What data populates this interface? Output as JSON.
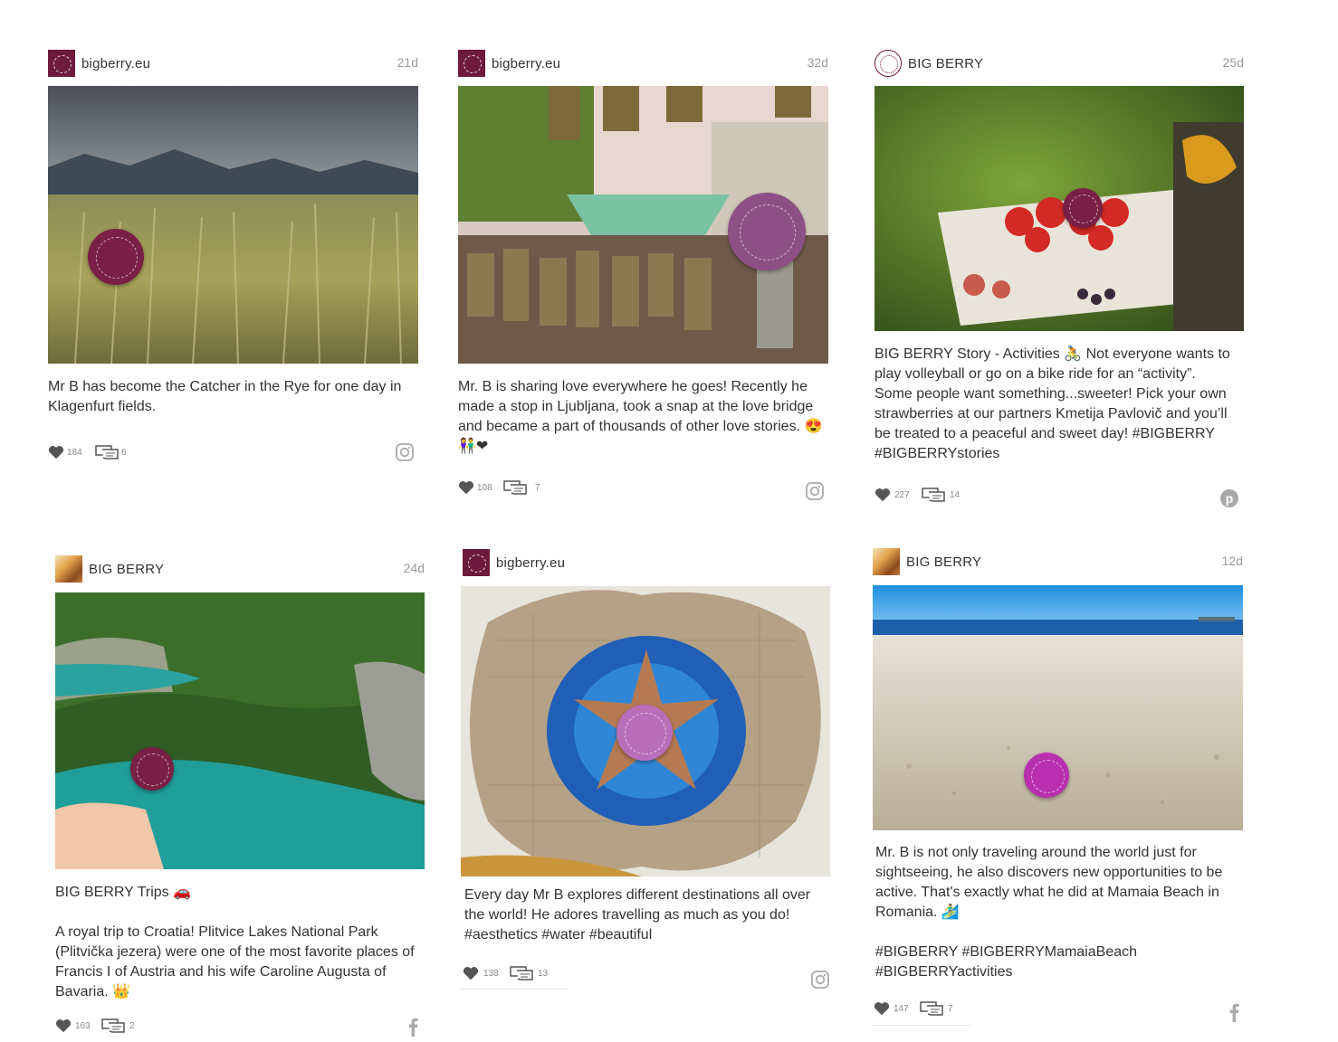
{
  "posts": [
    {
      "username": "bigberry.eu",
      "age": "21d",
      "caption": "Mr B has become the Catcher in the Rye for one day in Klagenfurt fields.",
      "likes": "184",
      "comments": "6",
      "source": "instagram-icon"
    },
    {
      "username": "bigberry.eu",
      "age": "32d",
      "caption": "Mr. B is sharing love everywhere he goes! Recently he made a stop in Ljubljana, took a snap at the love bridge and became a part of thousands of other love stories. 😍 👫❤",
      "likes": "108",
      "comments": "7",
      "source": "instagram-icon"
    },
    {
      "username": "BIG BERRY",
      "age": "25d",
      "caption": "BIG BERRY Story - Activities 🚴 Not everyone wants to play volleyball or go on a bike ride for an “activity”. Some people want something...sweeter! Pick your own strawberries at our partners Kmetija Pavlovič and you’ll be treated to a peaceful and sweet day! #BIGBERRY #BIGBERRYstories",
      "likes": "227",
      "comments": "14",
      "source": "pinterest-icon"
    },
    {
      "username": "BIG BERRY",
      "age": "24d",
      "caption": "BIG BERRY Trips 🚗\n\nA royal trip to Croatia! Plitvice Lakes National Park (Plitvička jezera) were one of the most favorite places of Francis I of Austria and his wife Caroline Augusta of Bavaria. 👑",
      "likes": "163",
      "comments": "2",
      "source": "facebook-icon"
    },
    {
      "username": "bigberry.eu",
      "age": "",
      "caption": "Every day Mr B explores different destinations all over the world! He adores travelling as much as you do! #aesthetics #water #beautiful",
      "likes": "138",
      "comments": "13",
      "source": "instagram-icon"
    },
    {
      "username": "BIG BERRY",
      "age": "12d",
      "caption": "Mr. B is not only traveling around the world just for sightseeing, he also discovers new opportunities to be active. That's exactly what he did at Mamaia Beach in Romania.   🏄‍♂️\n\n#BIGBERRY #BIGBERRYMamaiaBeach #BIGBERRYactivities",
      "likes": "147",
      "comments": "7",
      "source": "facebook-icon"
    }
  ],
  "colors": {
    "brand": "#6e1a3c",
    "text": "#333333",
    "muted": "#888888",
    "icon": "#555555"
  }
}
